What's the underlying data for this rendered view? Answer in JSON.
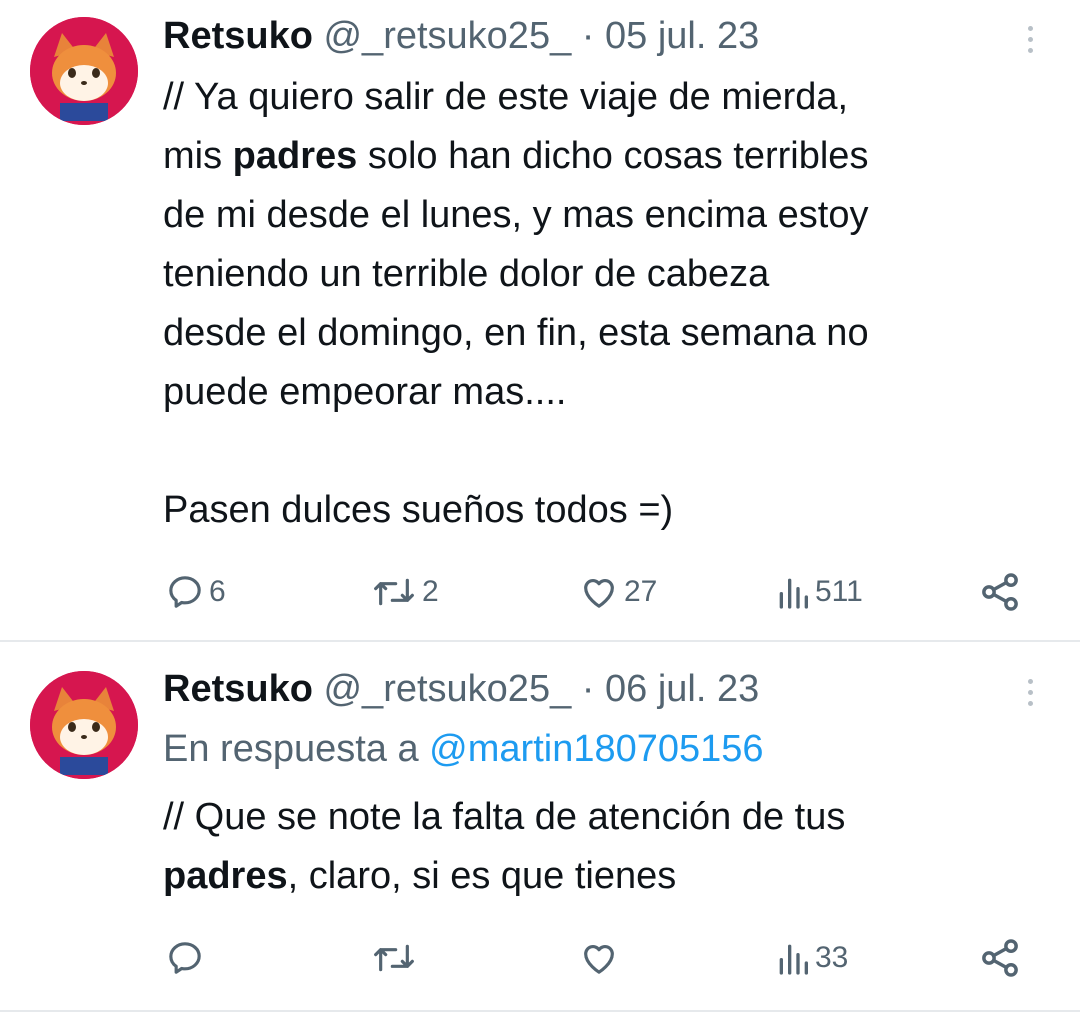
{
  "tweets": [
    {
      "name": "Retsuko",
      "handle": "@_retsuko25_",
      "separator": " · ",
      "date": "05 jul. 23",
      "text_parts": [
        "// Ya quiero salir de este viaje de mierda,\nmis ",
        "padres",
        " solo han dicho cosas terribles\nde mi desde el lunes, y mas encima estoy\nteniendo un terrible dolor de cabeza\ndesde el domingo, en fin, esta semana no\npuede empeorar mas....\n\nPasen dulces sueños todos =)"
      ],
      "counts": {
        "replies": "6",
        "retweets": "2",
        "likes": "27",
        "views": "511"
      }
    },
    {
      "name": "Retsuko",
      "handle": "@_retsuko25_",
      "separator": " · ",
      "date": "06 jul. 23",
      "reply_prefix": "En respuesta a ",
      "reply_mention": "@martin180705156",
      "text_parts": [
        "// Que se note la falta de atención de tus\n",
        "padres",
        ", claro, si es que tienes"
      ],
      "counts": {
        "replies": "",
        "retweets": "",
        "likes": "",
        "views": "33"
      }
    }
  ],
  "icons": [
    "reply-icon",
    "retweet-icon",
    "like-icon",
    "views-icon",
    "share-icon",
    "more-icon"
  ],
  "colors": {
    "text": "#0f1419",
    "secondary": "#536471",
    "link": "#1d9bf0",
    "avatar_bg": "#d6164f"
  }
}
